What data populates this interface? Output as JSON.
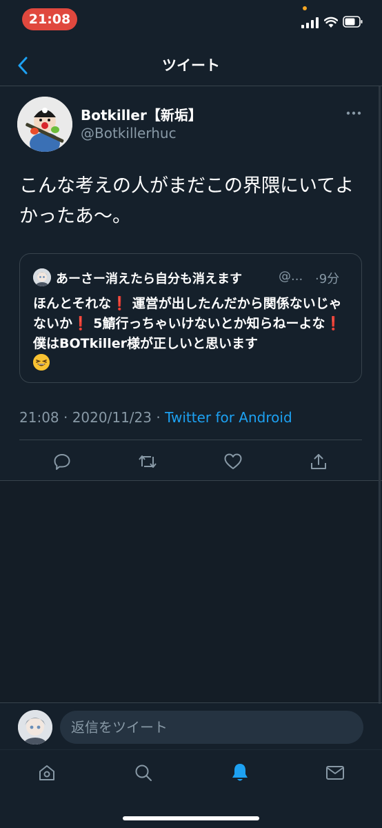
{
  "status_bar": {
    "time": "21:08",
    "icons": [
      "signal-icon",
      "wifi-icon",
      "battery-icon"
    ]
  },
  "nav": {
    "title": "ツイート",
    "back_icon": "back-chevron-icon"
  },
  "tweet": {
    "display_name": "Botkiller【新垢】",
    "handle": "@Botkillerhuc",
    "text": "こんな考えの人がまだこの界隈にいてよかったあ〜。",
    "timestamp": "21:08 · 2020/11/23 · ",
    "source": "Twitter for Android",
    "actions": [
      "reply-icon",
      "retweet-icon",
      "like-icon",
      "share-icon"
    ]
  },
  "quote": {
    "display_name": "あーさー消えたら自分も消えます",
    "handle": "@...",
    "time": "·9分",
    "segments": [
      "ほんとそれな",
      "❗",
      " 運営が出したんだから関係ないじゃないか",
      "❗",
      " 5鯖行っちゃいけないとか知らねーよな",
      "❗",
      " 僕はBOTkiller様が正しいと思います"
    ],
    "emoji": "grinning-squinting-face"
  },
  "reply_bar": {
    "placeholder": "返信をツイート"
  },
  "tab_bar": {
    "tabs": [
      "home-icon",
      "search-icon",
      "notifications-icon",
      "messages-icon"
    ],
    "active": "notifications-icon"
  },
  "colors": {
    "background": "#15202b",
    "accent": "#1da1f2",
    "secondary_text": "#8899a6",
    "border": "#38444d",
    "status_time_bg": "#e0483e"
  }
}
